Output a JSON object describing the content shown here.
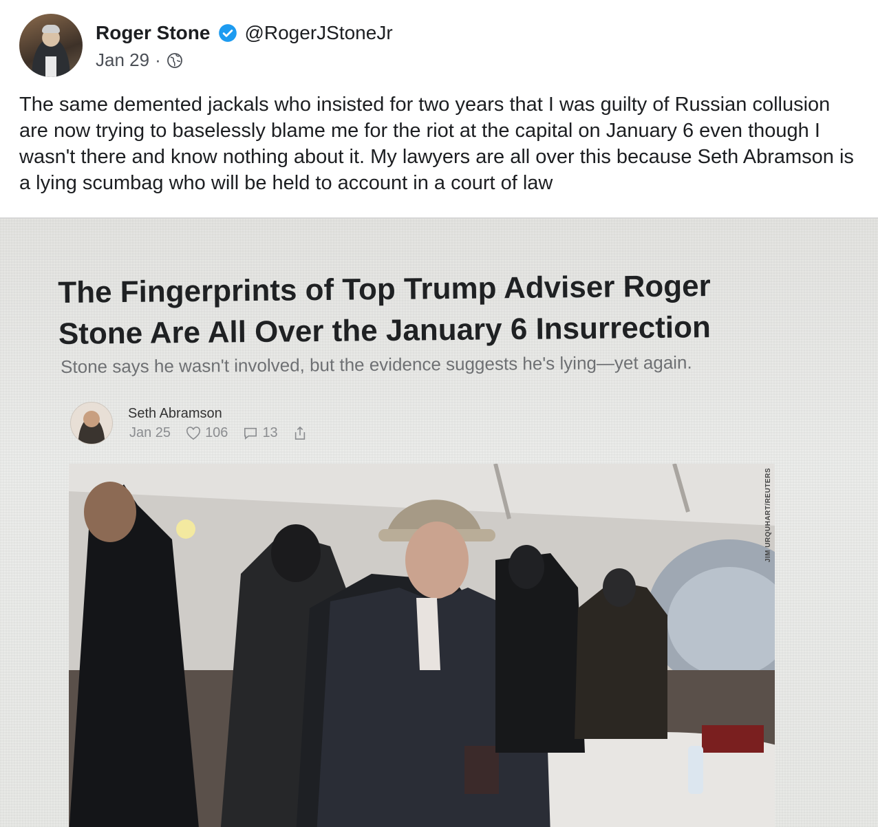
{
  "post": {
    "author_name": "Roger Stone",
    "handle": "@RogerJStoneJr",
    "date": "Jan 29",
    "separator": "·",
    "privacy_icon": "globe-icon",
    "verified_icon": "verified-badge-icon",
    "text": "The same demented jackals who insisted for two years that I was guilty of Russian collusion are now trying to baselessly blame me for the riot at the capital on January 6 even though I wasn't there and know nothing about it. My lawyers are all over this because Seth Abramson is a lying scumbag who will be held to account in a court of law"
  },
  "article": {
    "title": "The Fingerprints of Top Trump Adviser Roger Stone Are All Over the January 6 Insurrection",
    "subtitle": "Stone says he wasn't involved, but the evidence suggests he's lying—yet again.",
    "author": "Seth Abramson",
    "date": "Jan 25",
    "likes": "106",
    "comments": "13",
    "like_icon": "heart-icon",
    "comment_icon": "comment-icon",
    "share_icon": "share-icon",
    "photo_credit": "JIM URQUHART/REUTERS"
  },
  "colors": {
    "verified_blue": "#1d9bf0",
    "text": "#1c1e21",
    "meta_gray": "#4b4f56"
  }
}
